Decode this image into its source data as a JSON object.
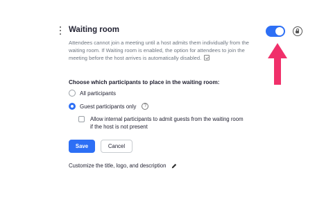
{
  "section": {
    "title": "Waiting room",
    "description": "Attendees cannot join a meeting until a host admits them individually from the waiting room. If Waiting room is enabled, the option for attendees to join the meeting before the host arrives is automatically disabled.",
    "enabled": true,
    "toggle_color": "#2d6ff5"
  },
  "options": {
    "label": "Choose which participants to place in the waiting room:",
    "all_participants": "All participants",
    "guest_participants": "Guest participants only",
    "selected": "guest_participants",
    "allow_internal": "Allow internal participants to admit guests from the waiting room if the host is not present",
    "allow_internal_checked": false
  },
  "buttons": {
    "save": "Save",
    "cancel": "Cancel"
  },
  "customize": {
    "label": "Customize the title, logo, and description"
  },
  "icons": {
    "drag": "drag-handle-icon",
    "lock": "lock-icon",
    "help": "help-icon",
    "edit": "pencil-icon",
    "note": "note-icon",
    "annotation": "arrow-up-icon"
  },
  "colors": {
    "accent": "#2d6ff5",
    "annotation_arrow": "#f0306a"
  }
}
